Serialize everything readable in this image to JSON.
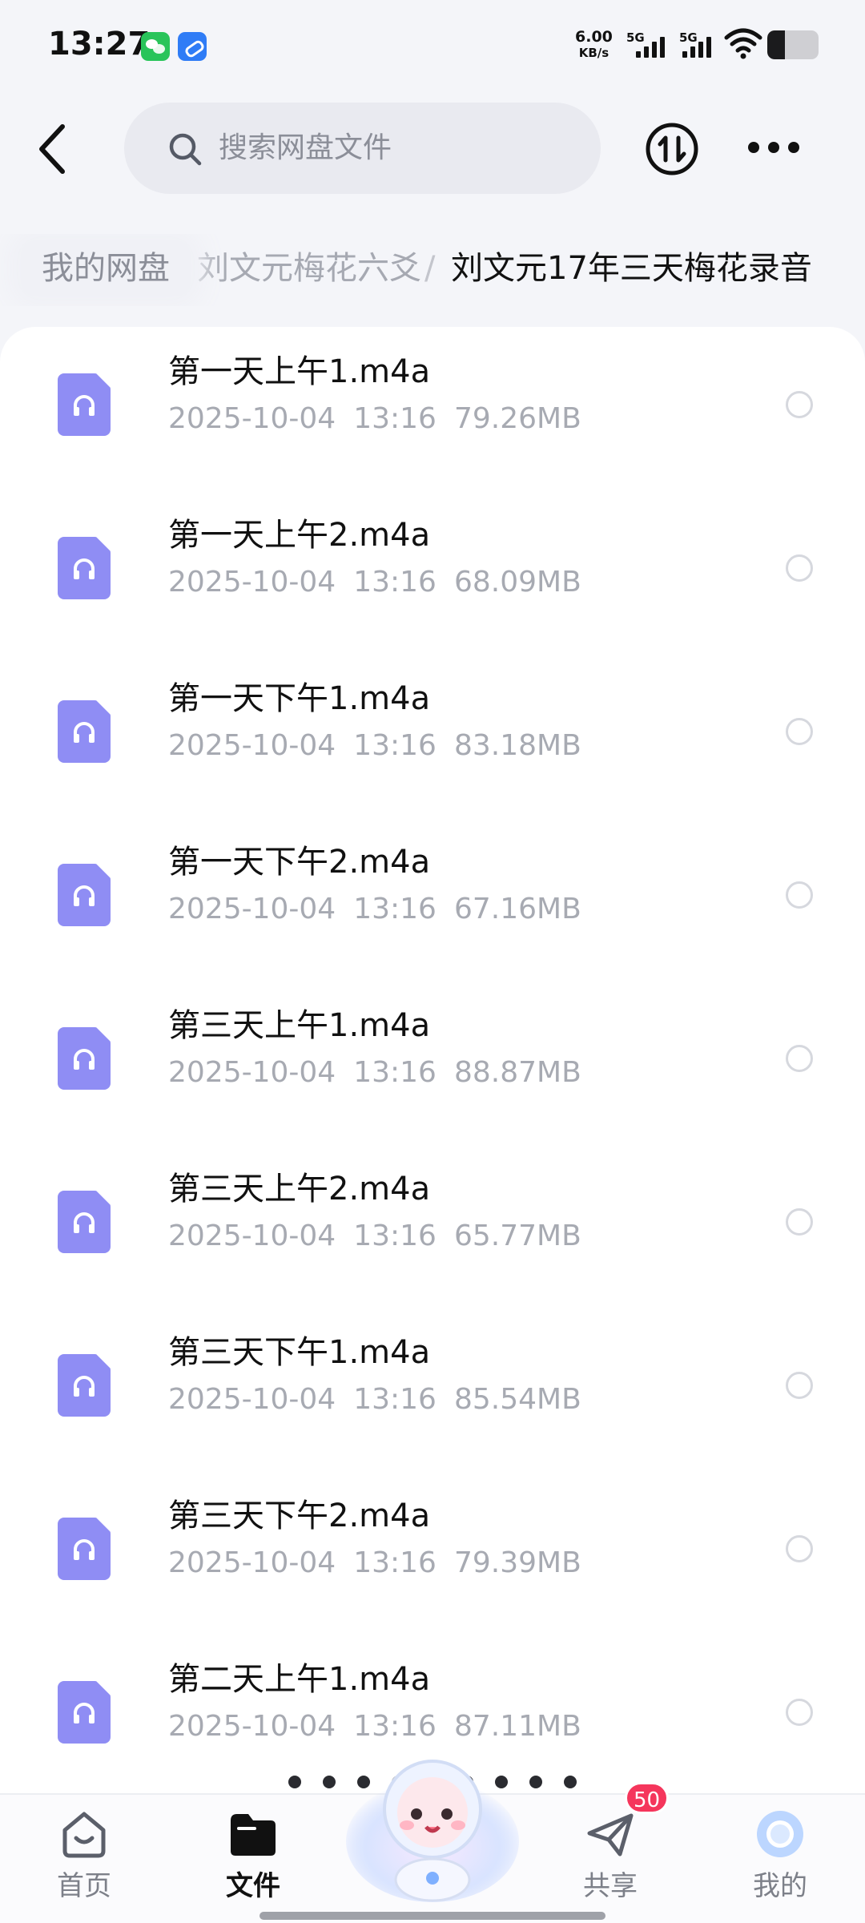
{
  "status_bar": {
    "time": "13:27",
    "net_speed_value": "6.00",
    "net_speed_unit": "KB/s",
    "signal_1_label": "5G",
    "signal_2_label": "5G",
    "battery_level": 0.35
  },
  "header": {
    "search_placeholder": "搜索网盘文件"
  },
  "breadcrumb": {
    "root": "我的网盘",
    "middle": "刘文元梅花六爻",
    "separator": "/",
    "current": "刘文元17年三天梅花录音"
  },
  "files": [
    {
      "name": "第一天上午1.m4a",
      "date": "2025-10-04",
      "time": "13:16",
      "size": "79.26MB"
    },
    {
      "name": "第一天上午2.m4a",
      "date": "2025-10-04",
      "time": "13:16",
      "size": "68.09MB"
    },
    {
      "name": "第一天下午1.m4a",
      "date": "2025-10-04",
      "time": "13:16",
      "size": "83.18MB"
    },
    {
      "name": "第一天下午2.m4a",
      "date": "2025-10-04",
      "time": "13:16",
      "size": "67.16MB"
    },
    {
      "name": "第三天上午1.m4a",
      "date": "2025-10-04",
      "time": "13:16",
      "size": "88.87MB"
    },
    {
      "name": "第三天上午2.m4a",
      "date": "2025-10-04",
      "time": "13:16",
      "size": "65.77MB"
    },
    {
      "name": "第三天下午1.m4a",
      "date": "2025-10-04",
      "time": "13:16",
      "size": "85.54MB"
    },
    {
      "name": "第三天下午2.m4a",
      "date": "2025-10-04",
      "time": "13:16",
      "size": "79.39MB"
    },
    {
      "name": "第二天上午1.m4a",
      "date": "2025-10-04",
      "time": "13:16",
      "size": "87.11MB"
    }
  ],
  "bottom_nav": {
    "home": "首页",
    "files": "文件",
    "share": "共享",
    "share_badge": "50",
    "mine": "我的"
  },
  "colors": {
    "file_icon": "#8f8df4",
    "badge": "#f5365c",
    "mine_avatar": "#bcd6ff"
  }
}
